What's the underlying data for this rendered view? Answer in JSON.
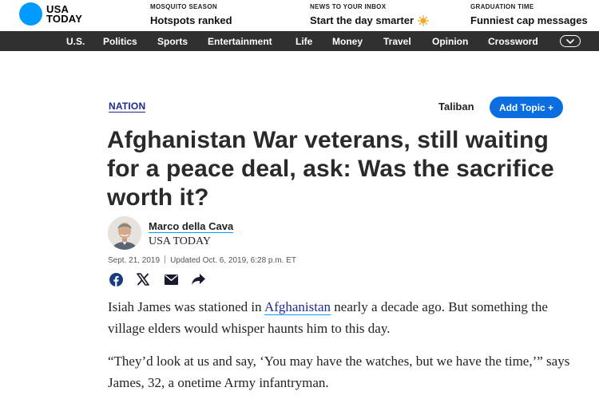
{
  "brand": {
    "line1": "USA",
    "line2": "TODAY",
    "color": "#009bff"
  },
  "promos": [
    {
      "kicker": "MOSQUITO SEASON",
      "headline": "Hotspots ranked"
    },
    {
      "kicker": "NEWS TO YOUR INBOX",
      "headline": "Start the day smarter",
      "icon": "sun-icon"
    },
    {
      "kicker": "GRADUATION TIME",
      "headline": "Funniest cap messages"
    }
  ],
  "nav": {
    "items": [
      "U.S.",
      "Politics",
      "Sports",
      "Entertainment",
      "Life",
      "Money",
      "Travel",
      "Opinion",
      "Crossword"
    ],
    "more_icon": "chevron-down-icon"
  },
  "article": {
    "section": "NATION",
    "topic": "Taliban",
    "add_topic": "Add Topic +",
    "title": "Afghanistan War veterans, still waiting for a peace deal, ask: Was the sacrifice worth it?",
    "author": "Marco della Cava",
    "outlet": "USA TODAY",
    "published": "Sept. 21, 2019",
    "updated": "Updated Oct. 6, 2019, 6:28 p.m. ET",
    "share_icons": [
      "facebook-icon",
      "x-icon",
      "email-icon",
      "share-arrow-icon"
    ],
    "para1_a": "Isiah James was stationed in ",
    "para1_link": "Afghanistan",
    "para1_b": " nearly a decade ago. But something the village elders would whisper haunts him to this day.",
    "para2": "“They’d look at us and say, ‘You may have the watches, but we have the time,’” says James, 32, a onetime Army infantryman."
  },
  "colors": {
    "nav_bg": "#303030",
    "accent": "#0a6ee0",
    "link": "#1b2b91"
  }
}
